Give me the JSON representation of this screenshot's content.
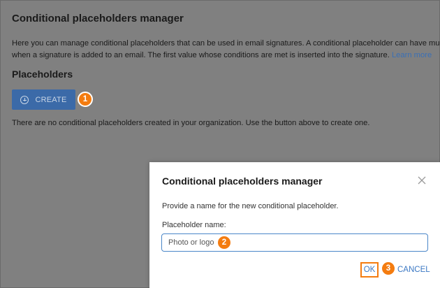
{
  "page": {
    "title": "Conditional placeholders manager",
    "description_line1": "Here you can manage conditional placeholders that can be used in email signatures. A conditional placeholder can have multip",
    "description_line2": "when a signature is added to an email. The first value whose conditions are met is inserted into the signature.",
    "learn_more": "Learn more",
    "section_title": "Placeholders",
    "create_button": "CREATE",
    "empty_message": "There are no conditional placeholders created in your organization. Use the button above to create one."
  },
  "dialog": {
    "title": "Conditional placeholders manager",
    "prompt": "Provide a name for the new conditional placeholder.",
    "field_label": "Placeholder name:",
    "input_value": "Photo or logo",
    "ok_button": "OK",
    "cancel_button": "CANCEL",
    "close_icon": "close-icon"
  },
  "callouts": [
    "1",
    "2",
    "3"
  ],
  "colors": {
    "overlay_gray": "#808080",
    "primary_button": "#3b6aa8",
    "callout_orange": "#f47c10",
    "link_blue": "#3b78c4",
    "input_border": "#4a86c8"
  }
}
